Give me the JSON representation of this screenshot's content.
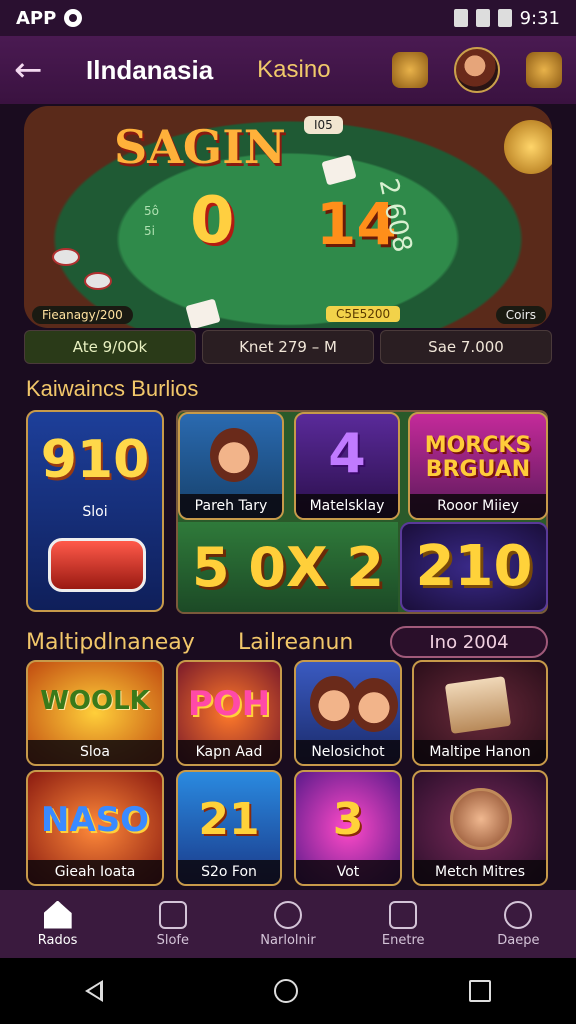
{
  "status": {
    "app_label": "APP",
    "time": "9:31"
  },
  "header": {
    "title": "Ilndanasia",
    "section": "Kasino"
  },
  "hero": {
    "sign": "SAGIN",
    "top_label": "I05",
    "num_o": "0",
    "num_14": "14",
    "side_label": "2 608",
    "felt_a": "5ô",
    "felt_b": "5i",
    "info_left": "Fieanagy/200",
    "info_mid": "C5E5200",
    "info_right": "Coirs"
  },
  "stats": [
    "Ate 9/0Ok",
    "Knet 279 – M",
    "Sae 7.000"
  ],
  "heading": "Kaiwaincs Burlios",
  "featured": {
    "slot_big": "910",
    "slot_label": "Sloi",
    "cowboy_label": "Pareh Tary",
    "four_big": "4",
    "four_label": "Matelsklay",
    "money_big": "MORCKS BRGUAN",
    "money_label": "Rooor Miiey",
    "green_big": "5 0X 2",
    "t210_big": "210"
  },
  "row2": {
    "left": "Maltipdlnaneay",
    "mid": "Lailreanun",
    "pill": "Ino 2004"
  },
  "games": [
    {
      "big": "WOOLK",
      "label": "Sloa"
    },
    {
      "big": "POH",
      "label": "Kapn Aad"
    },
    {
      "big": "",
      "label": "Nelosichot"
    },
    {
      "big": "",
      "label": "Maltipe Hanon"
    },
    {
      "big": "NASO",
      "label": "Gieah Ioata"
    },
    {
      "big": "21",
      "label": "S2o Fon"
    },
    {
      "big": "3",
      "label": "Vot"
    },
    {
      "big": "",
      "label": "Metch Mitres"
    }
  ],
  "nav": [
    {
      "label": "Rados",
      "icon": "home-icon"
    },
    {
      "label": "Slofe",
      "icon": "list-icon"
    },
    {
      "label": "Narlolnir",
      "icon": "search-icon"
    },
    {
      "label": "Enetre",
      "icon": "bell-icon"
    },
    {
      "label": "Daepe",
      "icon": "user-icon"
    }
  ]
}
